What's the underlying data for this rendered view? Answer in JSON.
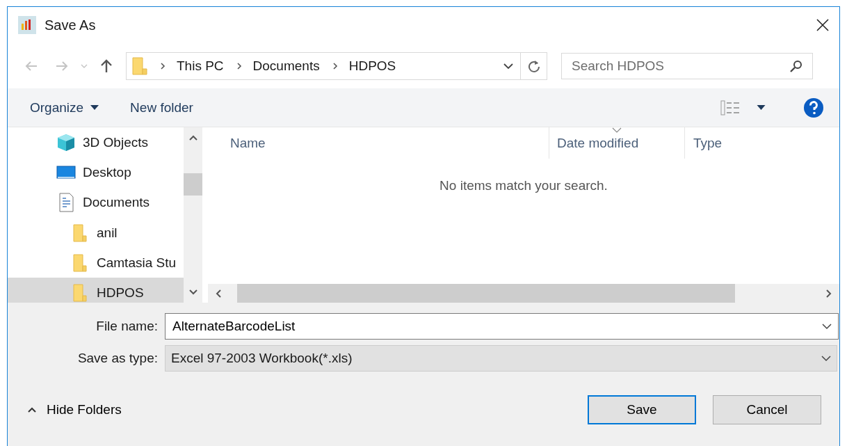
{
  "window": {
    "title": "Save As"
  },
  "address": {
    "breadcrumbs": [
      "This PC",
      "Documents",
      "HDPOS"
    ]
  },
  "search": {
    "placeholder": "Search HDPOS"
  },
  "toolbar": {
    "organize": "Organize",
    "new_folder": "New folder"
  },
  "sidebar": {
    "items": [
      {
        "label": "3D Objects",
        "kind": "cube",
        "selected": false
      },
      {
        "label": "Desktop",
        "kind": "desktop",
        "selected": false
      },
      {
        "label": "Documents",
        "kind": "document",
        "selected": false,
        "children": [
          {
            "label": "anil",
            "kind": "folder",
            "selected": false
          },
          {
            "label": "Camtasia Stu",
            "kind": "folder",
            "selected": false
          },
          {
            "label": "HDPOS",
            "kind": "folder",
            "selected": true
          }
        ]
      }
    ]
  },
  "table": {
    "columns": [
      {
        "label": "Name",
        "sorted": false
      },
      {
        "label": "Date modified",
        "sorted": true
      },
      {
        "label": "Type",
        "sorted": false
      }
    ],
    "empty_message": "No items match your search."
  },
  "form": {
    "file_name_label": "File name:",
    "file_name": "AlternateBarcodeList",
    "type_label": "Save as type:",
    "type": "Excel 97-2003 Workbook(*.xls)"
  },
  "footer": {
    "hide_folders": "Hide Folders",
    "buttons": [
      {
        "label": "Save",
        "default": true
      },
      {
        "label": "Cancel",
        "default": false
      }
    ]
  }
}
